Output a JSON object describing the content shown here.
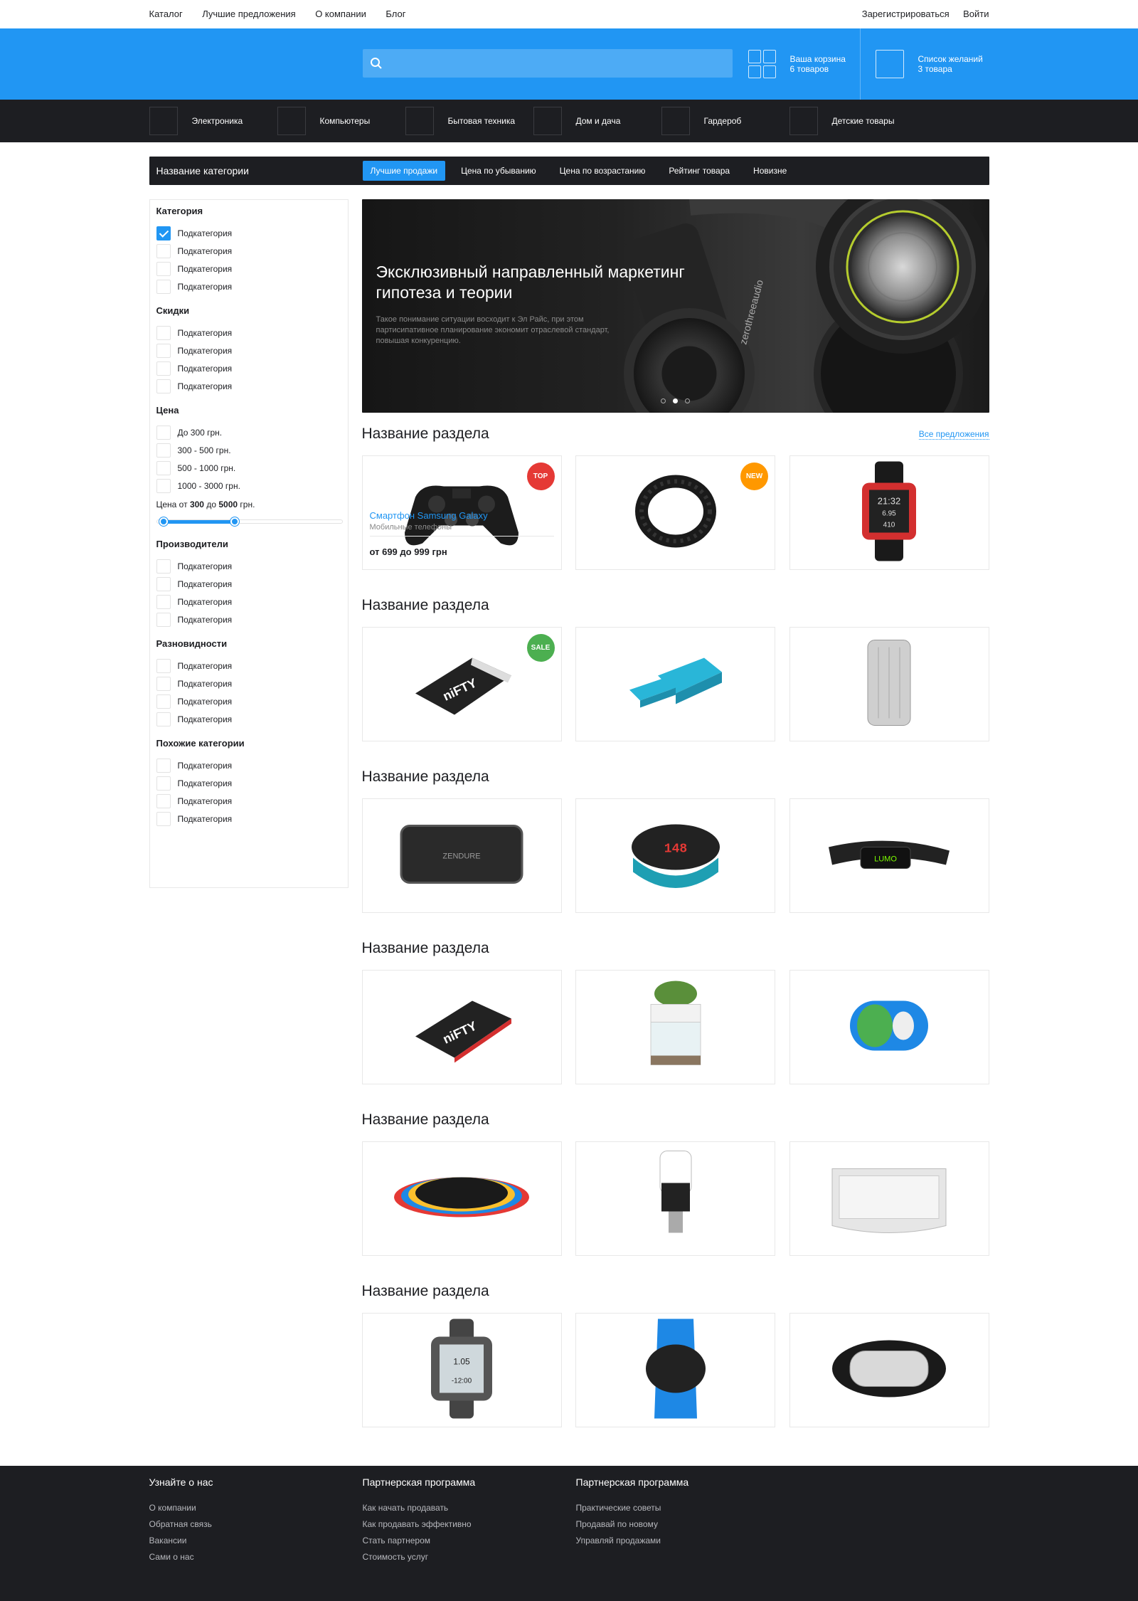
{
  "topnav": {
    "links": [
      "Каталог",
      "Лучшие предложения",
      "О компании",
      "Блог"
    ],
    "register": "Зарегистрироваться",
    "login": "Войти"
  },
  "header": {
    "search": {
      "placeholder": "",
      "icon": "search-icon"
    },
    "cart": {
      "label": "Ваша корзина",
      "count": "6 товаров"
    },
    "wishlist": {
      "label": "Список желаний",
      "count": "3 товара"
    },
    "colors": {
      "blue": "#2196f3",
      "dark": "#1d1e22"
    }
  },
  "categories": [
    "Электроника",
    "Компьютеры",
    "Бытовая техника",
    "Дом и дача",
    "Гардероб",
    "Детские товары"
  ],
  "toolbar": {
    "title": "Название категории",
    "tabs": [
      "Лучшие продажи",
      "Цена по убыванию",
      "Цена по возрастанию",
      "Рейтинг товара",
      "Новизне"
    ],
    "active_tab": "Лучшие продажи"
  },
  "sidebar": {
    "groups": [
      {
        "title": "Категория",
        "items": [
          "Подкатегория",
          "Подкатегория",
          "Подкатегория",
          "Подкатегория"
        ],
        "checked": [
          true,
          false,
          false,
          false
        ]
      },
      {
        "title": "Скидки",
        "items": [
          "Подкатегория",
          "Подкатегория",
          "Подкатегория",
          "Подкатегория"
        ]
      },
      {
        "title": "Цена",
        "items": [
          "До 300 грн.",
          "300 - 500 грн.",
          "500 - 1000 грн.",
          "1000 - 3000 грн."
        ]
      },
      {
        "title": "Производители",
        "items": [
          "Подкатегория",
          "Подкатегория",
          "Подкатегория",
          "Подкатегория"
        ]
      },
      {
        "title": "Разновидности",
        "items": [
          "Подкатегория",
          "Подкатегория",
          "Подкатегория",
          "Подкатегория"
        ]
      },
      {
        "title": "Похожие категории",
        "items": [
          "Подкатегория",
          "Подкатегория",
          "Подкатегория",
          "Подкатегория"
        ]
      }
    ],
    "price_range": {
      "prefix": "Цена от",
      "from": "300",
      "mid": "до",
      "to": "5000",
      "suffix": "грн."
    }
  },
  "banner": {
    "title": "Эксклюзивный направленный маркетинг гипотеза и теории",
    "text": "Такое понимание ситуации восходит к Эл Райс, при этом партисипативное планирование экономит отраслевой стандарт, повышая конкуренцию.",
    "slides": 3,
    "active_slide": 2
  },
  "sections": [
    {
      "title": "Название раздела",
      "link": "Все предложения",
      "products": [
        {
          "icon": "gamepad-icon",
          "badge": "TOP",
          "badge_color": "#e53935",
          "name": "Смартфон Samsung Galaxy",
          "category": "Мобильные телефоны",
          "price": "от 699 до 999 грн"
        },
        {
          "icon": "fitness-band-icon",
          "badge": "NEW",
          "badge_color": "#ff9800"
        },
        {
          "icon": "smartwatch-icon",
          "watch_time": "21:32",
          "watch_sub": "6.95",
          "watch_num": "410"
        }
      ]
    },
    {
      "title": "Название раздела",
      "products": [
        {
          "icon": "sd-card-icon",
          "badge": "SALE",
          "badge_color": "#4caf50",
          "card_text": "niFTY"
        },
        {
          "icon": "usb-stick-icon"
        },
        {
          "icon": "power-bank-icon"
        }
      ]
    },
    {
      "title": "Название раздела",
      "products": [
        {
          "icon": "battery-pack-icon",
          "card_text": "ZENDURE"
        },
        {
          "icon": "heart-rate-band-icon",
          "card_text": "148"
        },
        {
          "icon": "posture-sensor-icon",
          "card_text": "LUMO"
        }
      ]
    },
    {
      "title": "Название раздела",
      "products": [
        {
          "icon": "sd-card-red-icon",
          "card_text": "niFTY"
        },
        {
          "icon": "aquaponic-tank-icon"
        },
        {
          "icon": "robot-ball-icon"
        }
      ]
    },
    {
      "title": "Название раздела",
      "products": [
        {
          "icon": "sleep-mask-icon"
        },
        {
          "icon": "smart-bulb-icon"
        },
        {
          "icon": "speaker-dock-icon"
        }
      ]
    },
    {
      "title": "Название раздела",
      "products": [
        {
          "icon": "gps-watch-icon",
          "card_text": "1.05",
          "card_sub": "-12:00"
        },
        {
          "icon": "blue-band-icon"
        },
        {
          "icon": "silver-band-icon"
        }
      ]
    }
  ],
  "footer": {
    "cols": [
      {
        "title": "Узнайте о нас",
        "links": [
          "О компании",
          "Обратная связь",
          "Вакансии",
          "Сами о нас"
        ]
      },
      {
        "title": "Партнерская программа",
        "links": [
          "Как начать продавать",
          "Как продавать эффективно",
          "Стать партнером",
          "Стоимость услуг"
        ]
      },
      {
        "title": "Партнерская программа",
        "links": [
          "Практические советы",
          "Продавай по новому",
          "Управляй продажами"
        ]
      }
    ]
  }
}
